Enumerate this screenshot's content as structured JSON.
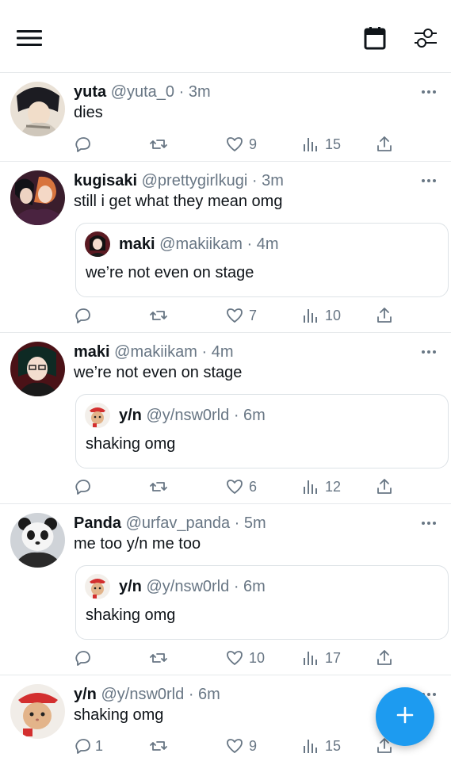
{
  "topbar": {
    "menu_icon": "hamburger-menu-icon",
    "calendar_icon": "calendar-icon",
    "filter_icon": "sliders-icon"
  },
  "tweets": [
    {
      "name": "yuta",
      "handle": "@yuta_0",
      "time": "3m",
      "text": "dies",
      "counts": {
        "reply": "",
        "like": "9",
        "views": "15"
      }
    },
    {
      "name": "kugisaki",
      "handle": "@prettygirlkugi",
      "time": "3m",
      "text": "still i get what they mean omg",
      "quote": {
        "name": "maki",
        "handle": "@makiikam",
        "time": "4m",
        "text": "we’re not even on stage"
      },
      "counts": {
        "reply": "",
        "like": "7",
        "views": "10"
      }
    },
    {
      "name": "maki",
      "handle": "@makiikam",
      "time": "4m",
      "text": "we’re not even on stage",
      "quote": {
        "name": "y/n",
        "handle": "@y/nsw0rld",
        "time": "6m",
        "text": "shaking omg"
      },
      "counts": {
        "reply": "",
        "like": "6",
        "views": "12"
      }
    },
    {
      "name": "Panda",
      "handle": "@urfav_panda",
      "time": "5m",
      "text": "me too y/n me too",
      "quote": {
        "name": "y/n",
        "handle": "@y/nsw0rld",
        "time": "6m",
        "text": "shaking omg"
      },
      "counts": {
        "reply": "",
        "like": "10",
        "views": "17"
      }
    },
    {
      "name": "y/n",
      "handle": "@y/nsw0rld",
      "time": "6m",
      "text": "shaking omg",
      "counts": {
        "reply": "1",
        "like": "9",
        "views": "15"
      }
    }
  ],
  "fab": {
    "icon": "plus-icon"
  },
  "colors": {
    "accent": "#1d9bf0",
    "muted": "#687684",
    "border": "#e6e9eb"
  }
}
